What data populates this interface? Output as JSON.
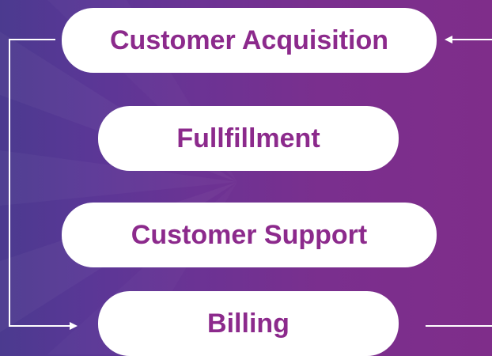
{
  "diagram": {
    "steps": [
      {
        "label": "Customer Acquisition"
      },
      {
        "label": "Fullfillment"
      },
      {
        "label": "Customer Support"
      },
      {
        "label": "Billing"
      }
    ],
    "colors": {
      "pill_fill": "#ffffff",
      "label_text": "#8c2a8c",
      "connector": "#ffffff",
      "background_left": "#4b3a8f",
      "background_right": "#7f2d8a"
    }
  }
}
